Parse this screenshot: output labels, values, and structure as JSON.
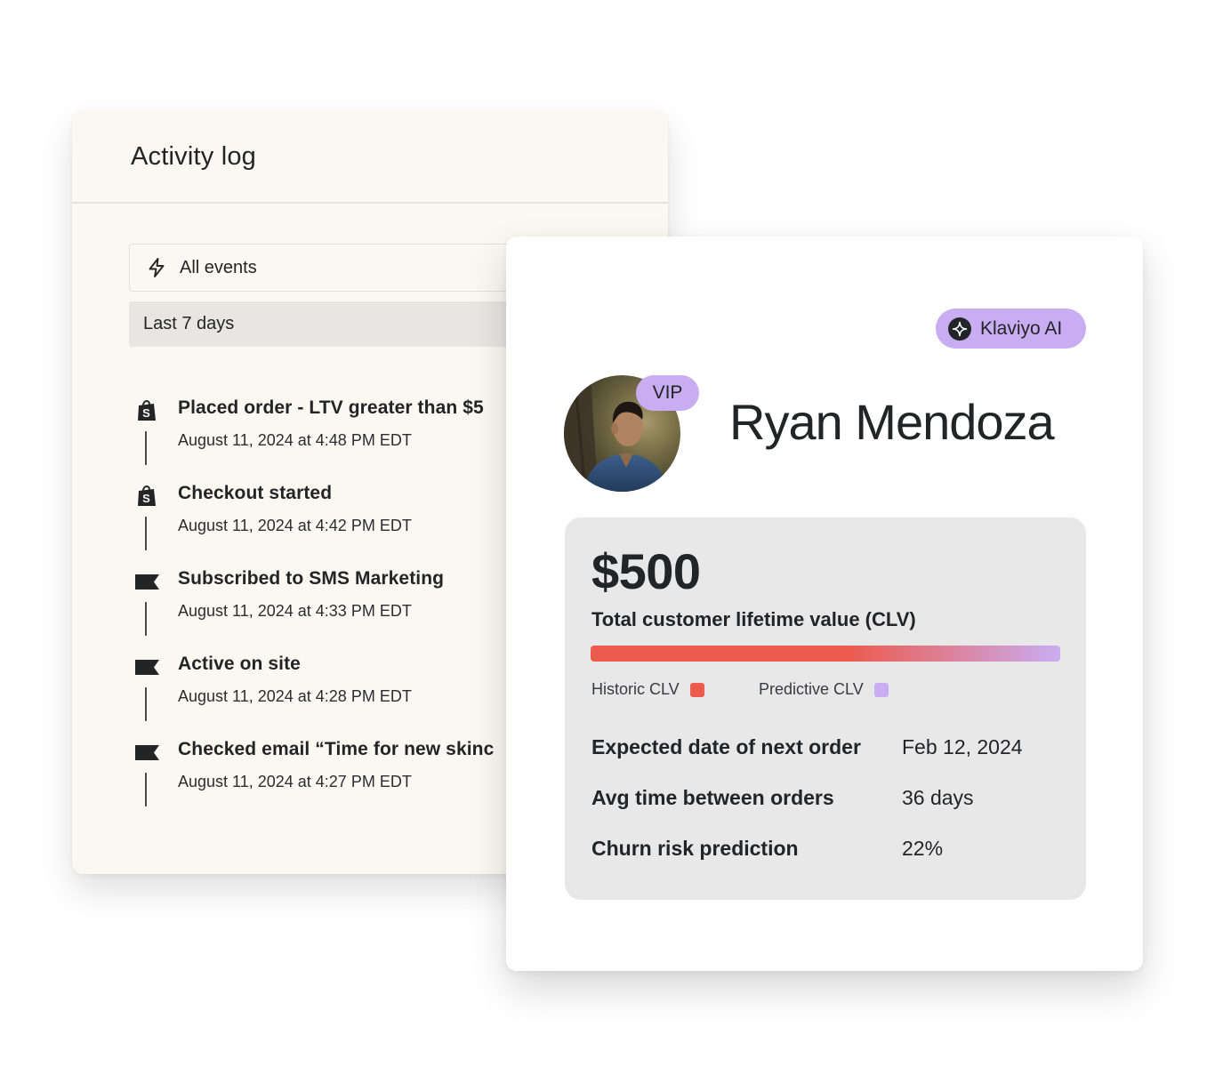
{
  "activity_log": {
    "title": "Activity log",
    "event_filter": {
      "label": "All events",
      "icon": "lightning-bolt-icon"
    },
    "range_filter": {
      "label": "Last 7 days"
    },
    "events": [
      {
        "title": "Placed order - LTV greater than $5",
        "time": "August 11, 2024 at 4:48 PM EDT",
        "icon": "shopify-bag-icon"
      },
      {
        "title": "Checkout started",
        "time": "August 11, 2024 at 4:42 PM EDT",
        "icon": "shopify-bag-icon"
      },
      {
        "title": "Subscribed to SMS Marketing",
        "time": "August 11, 2024 at 4:33 PM EDT",
        "icon": "flag-icon"
      },
      {
        "title": "Active on site",
        "time": "August 11, 2024 at 4:28 PM EDT",
        "icon": "flag-icon"
      },
      {
        "title": "Checked email “Time for new skinc",
        "time": "August 11, 2024 at 4:27 PM EDT",
        "icon": "flag-icon"
      }
    ]
  },
  "profile": {
    "ai_badge": "Klaviyo AI",
    "vip_badge": "VIP",
    "name": "Ryan Mendoza",
    "clv": {
      "amount": "$500",
      "label": "Total customer lifetime value (CLV)",
      "legend": [
        {
          "label": "Historic CLV",
          "color": "#ec5b4d"
        },
        {
          "label": "Predictive CLV",
          "color": "#c9adf2"
        }
      ]
    },
    "stats": [
      {
        "key": "Expected date of next order",
        "value": "Feb 12, 2024"
      },
      {
        "key": "Avg time between orders",
        "value": "36 days"
      },
      {
        "key": "Churn risk prediction",
        "value": "22%"
      }
    ]
  },
  "colors": {
    "log_bg": "#fbf8f1",
    "accent_purple": "#c9adf2",
    "historic_red": "#ec5b4d",
    "panel_grey": "#e8e8e8"
  }
}
